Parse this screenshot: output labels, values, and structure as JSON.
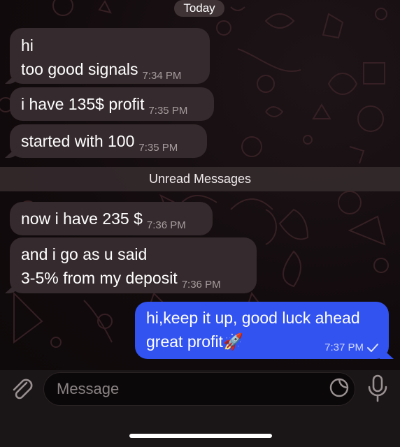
{
  "chat": {
    "date_separator": "Today",
    "unread_separator": "Unread Messages",
    "incoming": [
      {
        "lines": [
          "hi",
          "too good signals"
        ],
        "time": "7:34 PM"
      },
      {
        "lines": [
          "i have 135$ profit"
        ],
        "time": "7:35 PM"
      },
      {
        "lines": [
          "started with 100"
        ],
        "time": "7:35 PM"
      },
      {
        "lines": [
          "now i have 235 $"
        ],
        "time": "7:36 PM"
      },
      {
        "lines": [
          "and i go as u said",
          "3-5% from my deposit"
        ],
        "time": "7:36 PM"
      }
    ],
    "outgoing": {
      "line1": "hi,keep it up, good luck ahead",
      "line2": "great profit",
      "emoji": "🚀",
      "time": "7:37 PM",
      "status_icon": "checkmark-icon"
    }
  },
  "composer": {
    "placeholder": "Message",
    "attach_icon": "paperclip-icon",
    "sticker_icon": "sticker-icon",
    "mic_icon": "microphone-icon"
  },
  "colors": {
    "incoming_bubble": "#352a2d",
    "outgoing_bubble": "#3253f0",
    "background": "#0f0a0b"
  }
}
